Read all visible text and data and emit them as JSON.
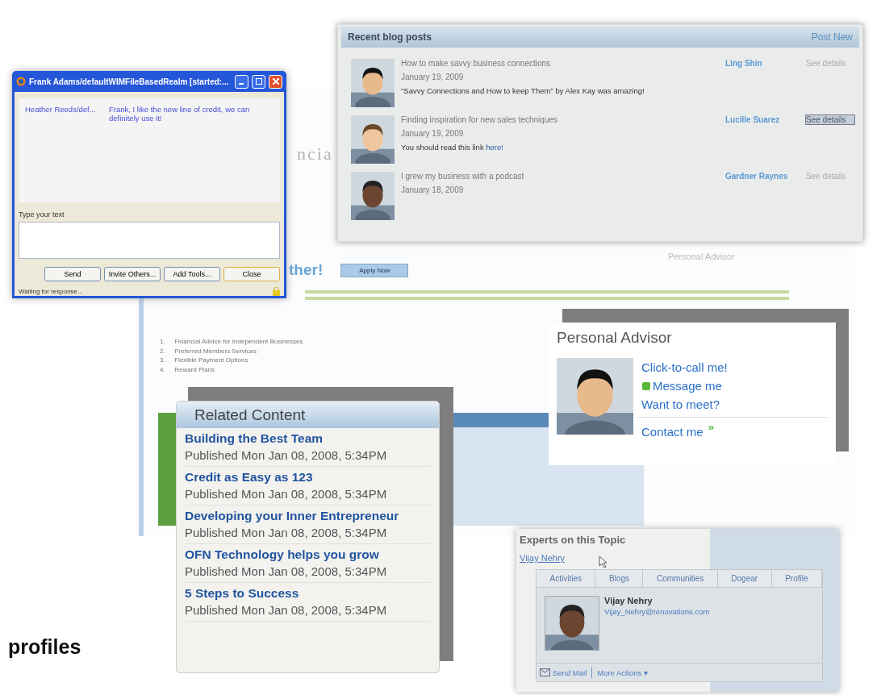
{
  "background_page": {
    "logo": "ncia",
    "apply_button": "Apply Now",
    "heading": "ther!",
    "sidebar_title": "Personal Advisor",
    "list": [
      {
        "number": "1.",
        "text": "Financial Advice for Independent Businesses"
      },
      {
        "number": "2.",
        "text": "Preferred Members Services"
      },
      {
        "number": "3.",
        "text": "Flexible Payment Options"
      },
      {
        "number": "4.",
        "text": "Reward Plans"
      }
    ]
  },
  "chat_window": {
    "title": "Frank Adams/defaultWIMFileBasedRealm [started:...",
    "messages": [
      {
        "sender": "Heather Reeds/def...",
        "text": "Frank, I like the new line of credit, we can definitely use it!"
      }
    ],
    "input_label": "Type your text",
    "buttons": [
      {
        "label": "Send",
        "selected": false
      },
      {
        "label": "Invite Others...",
        "selected": false
      },
      {
        "label": "Add Tools...",
        "selected": false
      },
      {
        "label": "Close",
        "selected": true
      }
    ],
    "status": "Waiting for response..."
  },
  "blog_posts": {
    "title": "Recent blog posts",
    "action": "Post New",
    "posts": [
      {
        "title": "How to make savvy business connections",
        "date": "January 19, 2009",
        "comment": "\"Savvy Connections and How to keep Them\" by Alex Kay was amazing!",
        "author": "Ling Shin",
        "details": "See details",
        "hovered": false
      },
      {
        "title": "Finding inspiration for new sales techniques",
        "date": "January 19, 2009",
        "comment": "You should read this link ",
        "link": "here!",
        "author": "Lucille Suarez",
        "details": "See details",
        "hovered": true
      },
      {
        "title": "I grew my business with a podcast",
        "date": "January 18, 2009",
        "author": "Gardner Raynes",
        "details": "See details",
        "hovered": false
      }
    ]
  },
  "personal_advisor": {
    "title": "Personal Advisor",
    "links": [
      {
        "label": "Click-to-call me!",
        "kind": "plain"
      },
      {
        "label": "Message me",
        "kind": "status"
      },
      {
        "label": "Want to meet?",
        "kind": "plain"
      }
    ],
    "contact": "Contact me",
    "contact_icon": "»"
  },
  "related_content": {
    "title": "Related Content",
    "items": [
      {
        "title": "Building the Best Team",
        "published": "Published Mon Jan 08, 2008, 5:34PM"
      },
      {
        "title": "Credit as Easy as 123",
        "published": "Published Mon Jan 08, 2008, 5:34PM"
      },
      {
        "title": "Developing your Inner Entrepreneur",
        "published": "Published Mon Jan 08, 2008, 5:34PM"
      },
      {
        "title": "OFN Technology helps you grow",
        "published": "Published Mon Jan 08, 2008, 5:34PM"
      },
      {
        "title": "5 Steps to Success",
        "published": "Published Mon Jan 08, 2008, 5:34PM"
      }
    ]
  },
  "experts": {
    "title": "Experts on this Topic",
    "expert": "Vijay Nehry",
    "tabs": [
      {
        "label": "Activities",
        "selected": false
      },
      {
        "label": "Blogs",
        "selected": false
      },
      {
        "label": "Communities",
        "selected": false
      },
      {
        "label": "Dogear",
        "selected": false
      },
      {
        "label": "Profile",
        "selected": false
      }
    ],
    "name": "Vijay Nehry",
    "email": "Vijay_Nehry@renovations.com",
    "actions": [
      "Send Mail",
      "More Actions ▾"
    ]
  },
  "caption": "profiles"
}
